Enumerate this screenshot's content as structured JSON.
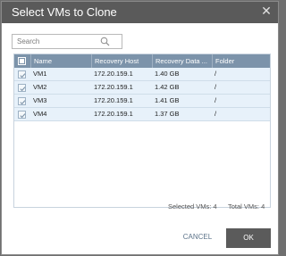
{
  "dialog": {
    "title": "Select VMs to Clone",
    "close_icon": "close-icon"
  },
  "search": {
    "placeholder": "Search",
    "value": "",
    "icon": "search-icon"
  },
  "grid": {
    "columns": [
      "Name",
      "Recovery Host",
      "Recovery Data ...",
      "Folder"
    ],
    "select_all_checked": true,
    "rows": [
      {
        "checked": true,
        "name": "VM1",
        "host": "172.20.159.1",
        "data": "1.40 GB",
        "folder": "/"
      },
      {
        "checked": true,
        "name": "VM2",
        "host": "172.20.159.1",
        "data": "1.42 GB",
        "folder": "/"
      },
      {
        "checked": true,
        "name": "VM3",
        "host": "172.20.159.1",
        "data": "1.41 GB",
        "folder": "/"
      },
      {
        "checked": true,
        "name": "VM4",
        "host": "172.20.159.1",
        "data": "1.37 GB",
        "folder": "/"
      }
    ]
  },
  "summary": {
    "selected": "Selected VMs: 4",
    "total": "Total VMs: 4"
  },
  "buttons": {
    "cancel": "CANCEL",
    "ok": "OK"
  },
  "colors": {
    "titlebar": "#5a5a5a",
    "grid_header": "#7c93aa",
    "row_background": "#e7f1fa",
    "ok_button": "#5b5b5b",
    "cancel_text": "#5d748a"
  }
}
